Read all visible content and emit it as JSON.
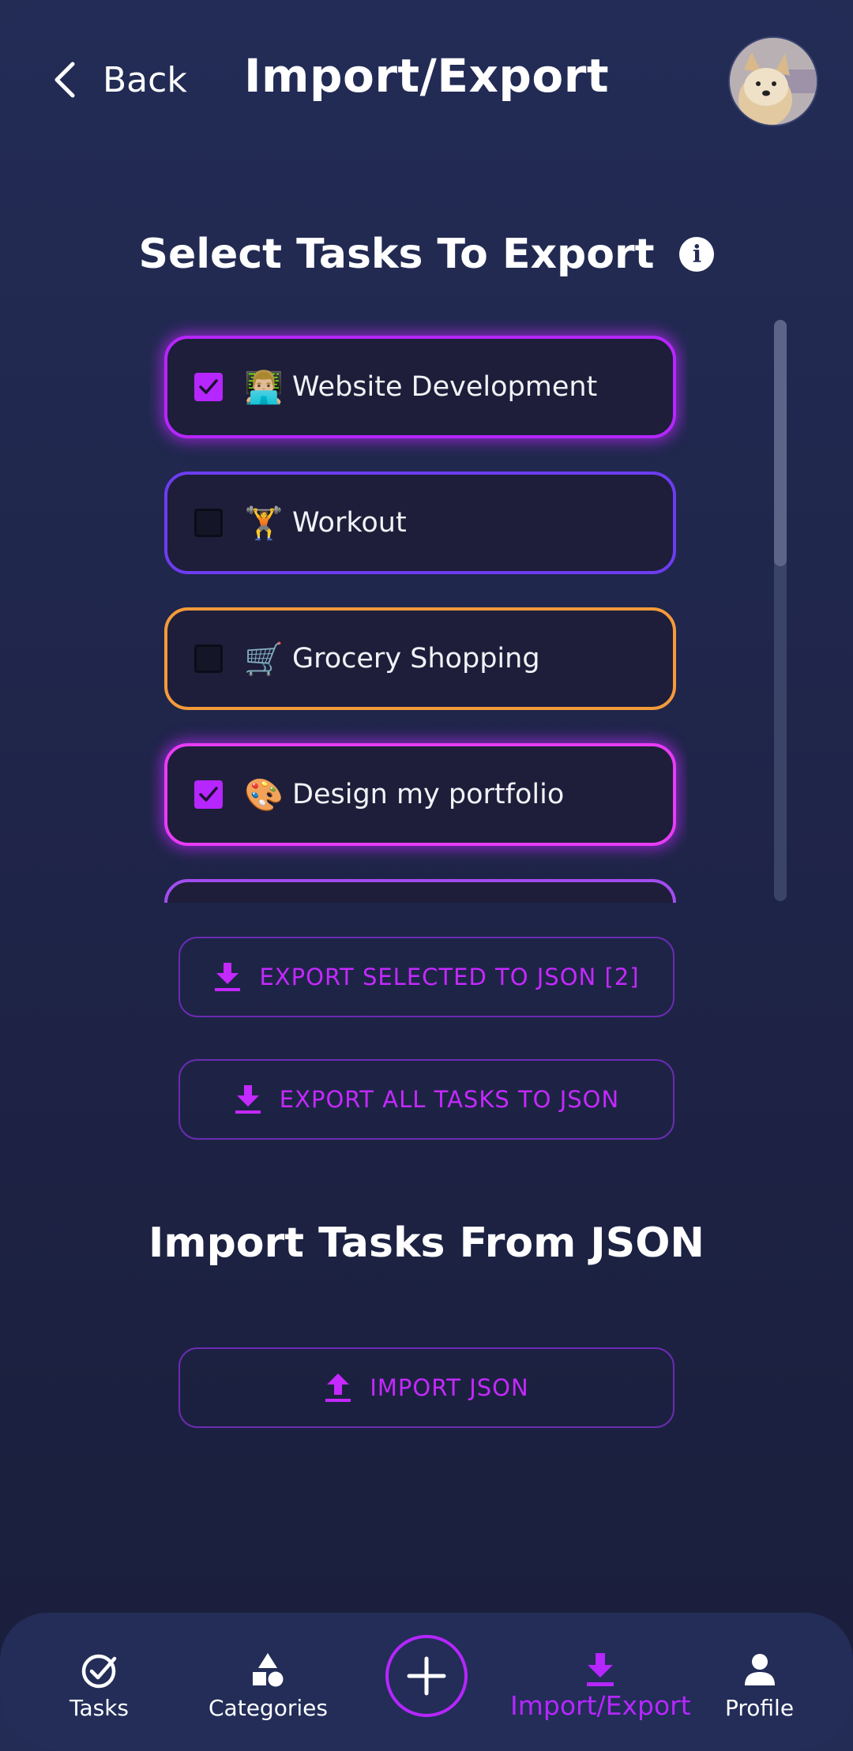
{
  "header": {
    "back_label": "Back",
    "title": "Import/Export",
    "avatar_icon": "profile-photo"
  },
  "export_section": {
    "title": "Select Tasks To Export",
    "info_icon": "info-icon",
    "tasks": [
      {
        "emoji": "👨🏼‍💻",
        "name": "Website Development",
        "checked": true,
        "border_color": "#b626ff"
      },
      {
        "emoji": "🏋️",
        "name": "Workout",
        "checked": false,
        "border_color": "#6d3cf0"
      },
      {
        "emoji": "🛒",
        "name": "Grocery Shopping",
        "checked": false,
        "border_color": "#f59a3a"
      },
      {
        "emoji": "🎨",
        "name": "Design my portfolio",
        "checked": true,
        "border_color": "#e83cf5"
      },
      {
        "emoji": "",
        "name": "",
        "checked": false,
        "border_color": "#a24df0"
      }
    ],
    "export_selected_label": "EXPORT SELECTED TO JSON [2]",
    "export_all_label": "EXPORT ALL TASKS TO JSON"
  },
  "import_section": {
    "title": "Import Tasks From JSON",
    "import_label": "IMPORT JSON"
  },
  "bottom_nav": {
    "items": [
      {
        "label": "Tasks",
        "icon": "check-circle-icon"
      },
      {
        "label": "Categories",
        "icon": "shapes-icon"
      },
      {
        "label": "Import/Export",
        "icon": "download-icon",
        "active": true
      },
      {
        "label": "Profile",
        "icon": "person-icon"
      }
    ],
    "add_icon": "plus-icon"
  },
  "colors": {
    "accent": "#b626ff",
    "background": "#232c56",
    "card": "#1e1e3a"
  }
}
